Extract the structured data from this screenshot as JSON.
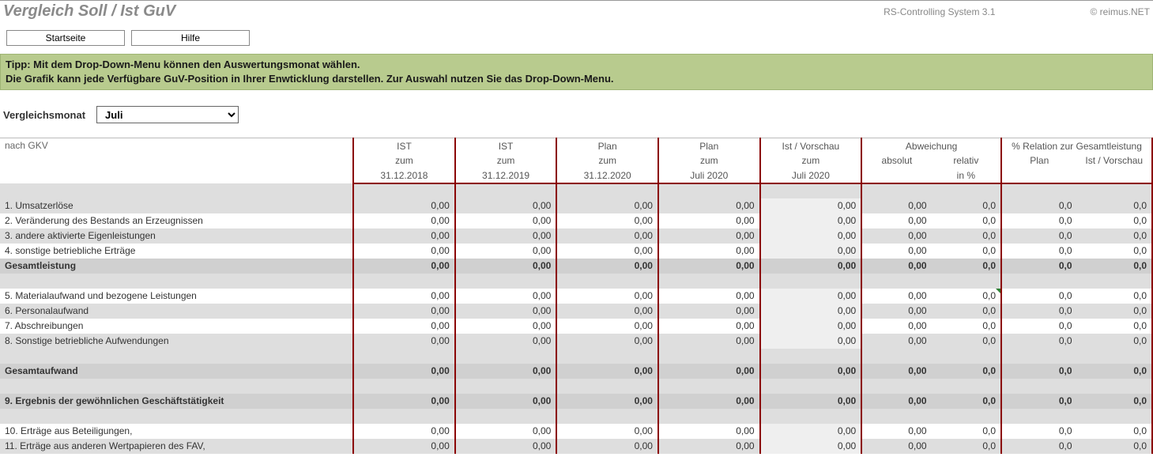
{
  "header": {
    "title": "Vergleich Soll / Ist GuV",
    "system": "RS-Controlling System 3.1",
    "brand": "© reimus.NET"
  },
  "buttons": {
    "home": "Startseite",
    "help": "Hilfe"
  },
  "tip": {
    "line1": "Tipp: Mit dem Drop-Down-Menu können den Auswertungsmonat wählen.",
    "line2": "Die Grafik kann jede Verfügbare GuV-Position in Ihrer Enwticklung darstellen. Zur Auswahl nutzen Sie das Drop-Down-Menu."
  },
  "month": {
    "label": "Vergleichsmonat",
    "value": "Juli"
  },
  "columns": {
    "left_header": "nach GKV",
    "groups": {
      "ist1": {
        "top": "IST",
        "mid": "zum",
        "bot": "31.12.2018"
      },
      "ist2": {
        "top": "IST",
        "mid": "zum",
        "bot": "31.12.2019"
      },
      "plan_full": {
        "top": "Plan",
        "mid": "zum",
        "bot": "31.12.2020"
      },
      "plan_month": {
        "top": "Plan",
        "mid": "zum",
        "bot": "Juli 2020"
      },
      "forecast": {
        "top": "Ist / Vorschau",
        "mid": "zum",
        "bot": "Juli 2020"
      },
      "abw": {
        "top": "Abweichung",
        "sub_abs": "absolut",
        "sub_rel": "relativ",
        "sub_rel2": "in %"
      },
      "rel": {
        "top": "% Relation zur Gesamtleistung",
        "sub_plan": "Plan",
        "sub_fc": "Ist / Vorschau"
      }
    }
  },
  "rows": [
    {
      "label": "1. Umsatzerlöse",
      "v": [
        "0,00",
        "0,00",
        "0,00",
        "0,00",
        "0,00",
        "0,00",
        "0,0",
        "0,0",
        "0,0"
      ],
      "type": "alt"
    },
    {
      "label": "2. Veränderung des Bestands an Erzeugnissen",
      "v": [
        "0,00",
        "0,00",
        "0,00",
        "0,00",
        "0,00",
        "0,00",
        "0,0",
        "0,0",
        "0,0"
      ],
      "type": "normal"
    },
    {
      "label": "3. andere aktivierte Eigenleistungen",
      "v": [
        "0,00",
        "0,00",
        "0,00",
        "0,00",
        "0,00",
        "0,00",
        "0,0",
        "0,0",
        "0,0"
      ],
      "type": "alt"
    },
    {
      "label": "4. sonstige betriebliche Erträge",
      "v": [
        "0,00",
        "0,00",
        "0,00",
        "0,00",
        "0,00",
        "0,00",
        "0,0",
        "0,0",
        "0,0"
      ],
      "type": "normal"
    },
    {
      "label": "Gesamtleistung",
      "v": [
        "0,00",
        "0,00",
        "0,00",
        "0,00",
        "0,00",
        "0,00",
        "0,0",
        "0,0",
        "0,0"
      ],
      "type": "bold",
      "triangle_last": true
    },
    {
      "label": "",
      "type": "spacer"
    },
    {
      "label": "5. Materialaufwand und bezogene Leistungen",
      "v": [
        "0,00",
        "0,00",
        "0,00",
        "0,00",
        "0,00",
        "0,00",
        "0,0",
        "0,0",
        "0,0"
      ],
      "type": "normal",
      "triangle_rel": true
    },
    {
      "label": "6. Personalaufwand",
      "v": [
        "0,00",
        "0,00",
        "0,00",
        "0,00",
        "0,00",
        "0,00",
        "0,0",
        "0,0",
        "0,0"
      ],
      "type": "alt"
    },
    {
      "label": "7. Abschreibungen",
      "v": [
        "0,00",
        "0,00",
        "0,00",
        "0,00",
        "0,00",
        "0,00",
        "0,0",
        "0,0",
        "0,0"
      ],
      "type": "normal"
    },
    {
      "label": "8. Sonstige betriebliche Aufwendungen",
      "v": [
        "0,00",
        "0,00",
        "0,00",
        "0,00",
        "0,00",
        "0,00",
        "0,0",
        "0,0",
        "0,0"
      ],
      "type": "alt"
    },
    {
      "label": "",
      "type": "spacer"
    },
    {
      "label": "Gesamtaufwand",
      "v": [
        "0,00",
        "0,00",
        "0,00",
        "0,00",
        "0,00",
        "0,00",
        "0,0",
        "0,0",
        "0,0"
      ],
      "type": "bold"
    },
    {
      "label": "",
      "type": "spacer"
    },
    {
      "label": "9. Ergebnis der gewöhnlichen Geschäftstätigkeit",
      "v": [
        "0,00",
        "0,00",
        "0,00",
        "0,00",
        "0,00",
        "0,00",
        "0,0",
        "0,0",
        "0,0"
      ],
      "type": "bold"
    },
    {
      "label": "",
      "type": "spacer"
    },
    {
      "label": "10. Erträge aus Beteiligungen,",
      "v": [
        "0,00",
        "0,00",
        "0,00",
        "0,00",
        "0,00",
        "0,00",
        "0,0",
        "0,0",
        "0,0"
      ],
      "type": "normal"
    },
    {
      "label": "11. Erträge aus anderen Wertpapieren des FAV,",
      "v": [
        "0,00",
        "0,00",
        "0,00",
        "0,00",
        "0,00",
        "0,00",
        "0,0",
        "0,0",
        "0,0"
      ],
      "type": "alt"
    }
  ]
}
